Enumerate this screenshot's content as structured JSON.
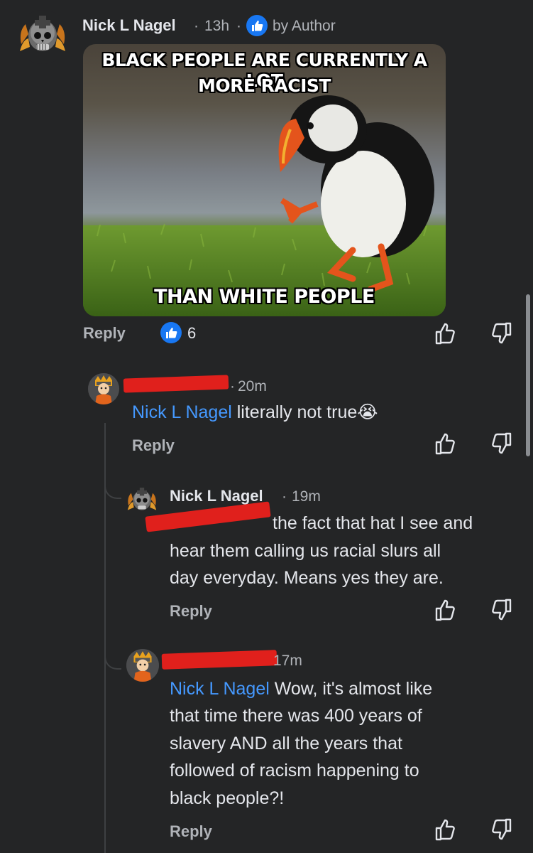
{
  "main_comment": {
    "author": "Nick L Nagel",
    "time": "13h",
    "separator": "·",
    "badge_label": "by Author",
    "meme": {
      "top_text_line1": "BLACK PEOPLE ARE CURRENTLY A LOT",
      "top_text_line2": "MORE RACIST",
      "bottom_text": "THAN WHITE PEOPLE"
    },
    "reply_label": "Reply",
    "like_count": "6"
  },
  "reply1": {
    "time": "20m",
    "mention": "Nick L Nagel",
    "text": " literally not true",
    "emoji": "😭",
    "reply_label": "Reply"
  },
  "reply2": {
    "author": "Nick L Nagel",
    "time": "19m",
    "text_line1": "the fact that hat I see and",
    "text_line2": "hear them calling us racial slurs all",
    "text_line3": "day everyday. Means yes they are.",
    "reply_label": "Reply"
  },
  "reply3": {
    "time": "17m",
    "mention": "Nick L Nagel",
    "text_line1": " Wow, it's almost like",
    "text_line2": "that time there was 400 years of",
    "text_line3": "slavery AND all the years that",
    "text_line4": "followed of racism happening to",
    "text_line5": "black people?!",
    "reply_label": "Reply"
  },
  "colors": {
    "background": "#242526",
    "mention": "#4599ff",
    "like_badge": "#1877f2",
    "redaction": "#e0201c"
  },
  "icons": [
    "skull-avatar-icon",
    "naruto-avatar-icon",
    "thumbs-up-icon",
    "thumbs-down-icon",
    "like-badge-icon"
  ]
}
